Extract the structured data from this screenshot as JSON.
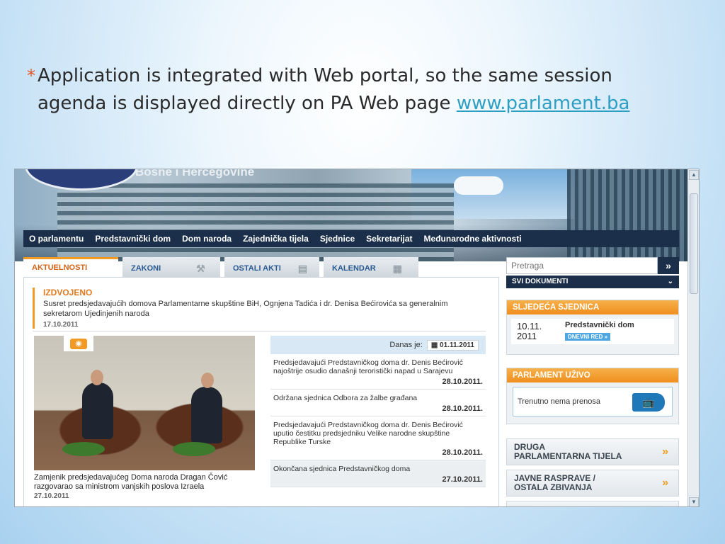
{
  "slide": {
    "bullet_text": "Application is integrated with Web portal, so the same session agenda is displayed directly on PA Web page",
    "bullet_link": "www.parlament.ba",
    "bullet_marker": "*"
  },
  "site": {
    "title": "Bosne i Hercegovine",
    "nav": [
      "O parlamentu",
      "Predstavnički dom",
      "Dom naroda",
      "Zajednička tijela",
      "Sjednice",
      "Sekretarijat",
      "Međunarodne aktivnosti"
    ],
    "tabs": [
      {
        "label": "AKTUELNOSTI",
        "active": true
      },
      {
        "label": "ZAKONI",
        "icon": "gavel-icon"
      },
      {
        "label": "OSTALI AKTI",
        "icon": "documents-icon"
      },
      {
        "label": "KALENDAR",
        "icon": "calendar-icon"
      }
    ],
    "featured": {
      "heading": "IZDVOJENO",
      "text": "Susret predsjedavajućih domova Parlamentarne skupštine BiH, Ognjena Tadića i dr. Denisa Bećirovića sa generalnim sekretarom Ujedinjenih naroda",
      "date": "17.10.2011"
    },
    "photo_caption": "Zamjenik predsjedavajućeg Doma naroda Dragan Čović razgovarao sa ministrom vanjskih poslova Izraela",
    "photo_date": "27.10.2011",
    "today_label": "Danas je:",
    "today_date": "01.11.2011",
    "news": [
      {
        "text": "Predsjedavajući Predstavničkog doma dr. Denis Bećirović najoštrije osudio današnji teroristički napad u Sarajevu",
        "date": "28.10.2011."
      },
      {
        "text": "Održana sjednica Odbora za žalbe građana",
        "date": "28.10.2011."
      },
      {
        "text": "Predsjedavajući Predstavničkog doma dr. Denis Bećirović uputio čestitku predsjedniku Velike narodne skupštine Republike Turske",
        "date": "28.10.2011."
      },
      {
        "text": "Okončana sjednica Predstavničkog doma",
        "date": "27.10.2011."
      }
    ],
    "search_placeholder": "Pretraga",
    "search_button": "»",
    "all_docs": "SVI DOKUMENTI",
    "next_session": {
      "heading": "SLJEDEĆA SJEDNICA",
      "date_line1": "10.11.",
      "date_line2": "2011",
      "title": "Predstavnički dom",
      "agenda_label": "DNEVNI RED »"
    },
    "live": {
      "heading": "PARLAMENT UŽIVO",
      "text": "Trenutno nema prenosa"
    },
    "links": [
      {
        "line1": "DRUGA",
        "line2": "PARLAMENTARNA TIJELA"
      },
      {
        "line1": "JAVNE RASPRAVE /",
        "line2": "OSTALA ZBIVANJA"
      }
    ],
    "link_arrow": "»"
  }
}
